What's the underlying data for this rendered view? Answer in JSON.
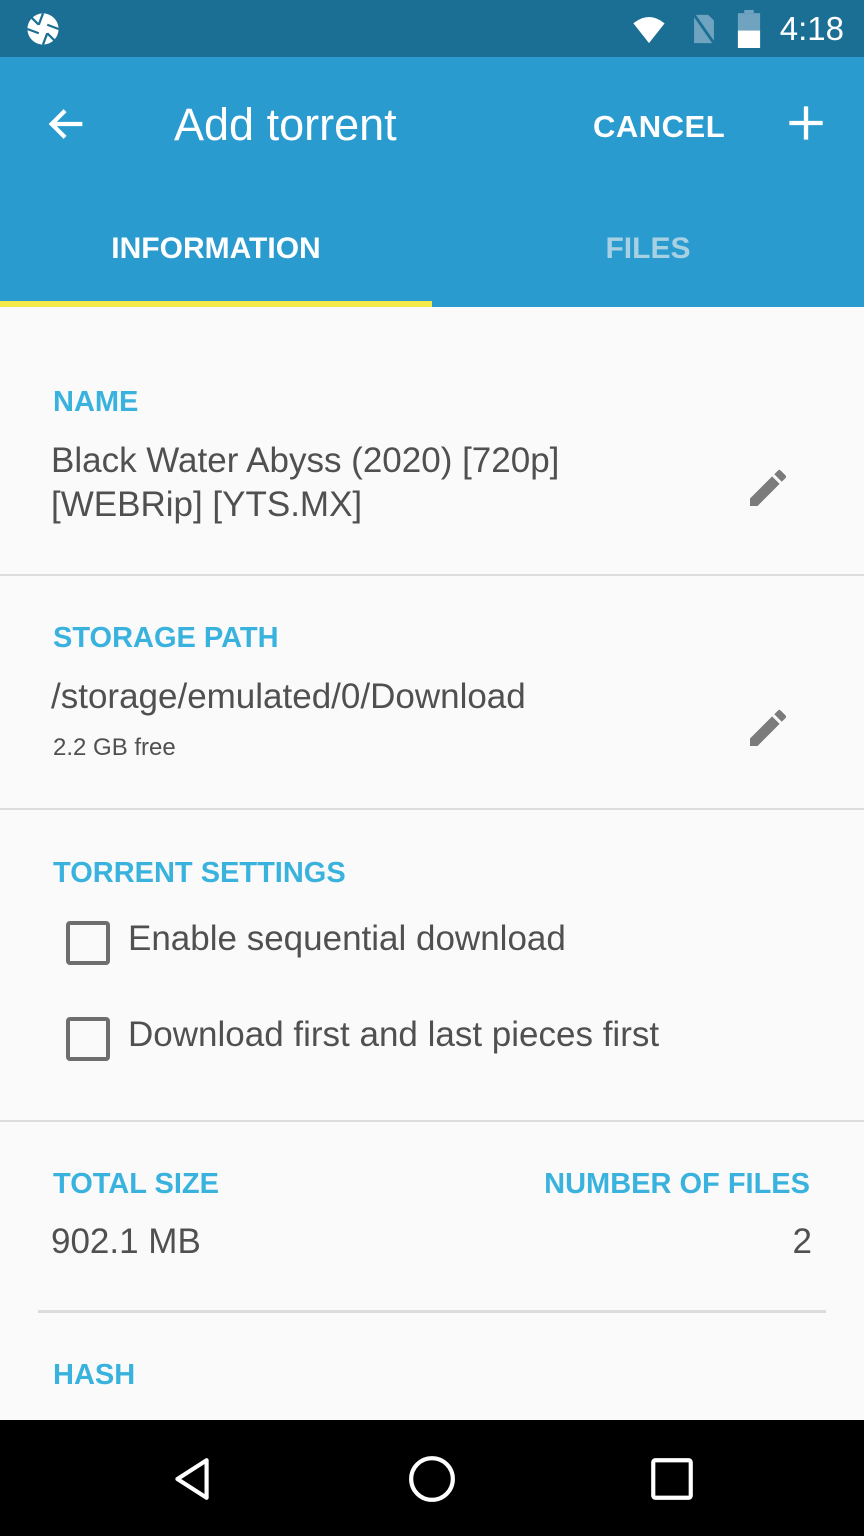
{
  "status_bar": {
    "time": "4:18",
    "icons": [
      "aperture-icon",
      "wifi-icon",
      "no-sim-icon",
      "battery-icon"
    ]
  },
  "app_bar": {
    "title": "Add torrent",
    "back_icon": "arrow-back-icon",
    "cancel_label": "CANCEL",
    "add_icon": "plus-icon"
  },
  "tabs": [
    {
      "label": "INFORMATION",
      "active": true
    },
    {
      "label": "FILES",
      "active": false
    }
  ],
  "name_section": {
    "label": "NAME",
    "value_line1": "Black Water Abyss (2020) [720p]",
    "value_line2": "[WEBRip] [YTS.MX]"
  },
  "storage_section": {
    "label": "STORAGE PATH",
    "path": "/storage/emulated/0/Download",
    "free": "2.2 GB free"
  },
  "settings_section": {
    "label": "TORRENT SETTINGS",
    "options": [
      {
        "label": "Enable sequential download",
        "checked": false
      },
      {
        "label": "Download first and last pieces first",
        "checked": false
      }
    ]
  },
  "size_section": {
    "total_size_label": "TOTAL SIZE",
    "total_size_value": "902.1 MB",
    "num_files_label": "NUMBER OF FILES",
    "num_files_value": "2"
  },
  "hash_section": {
    "label": "HASH"
  },
  "nav_bar": {
    "buttons": [
      "back-triangle-icon",
      "home-circle-icon",
      "recents-square-icon"
    ]
  },
  "colors": {
    "status_bar": "#1b6f94",
    "app_bar": "#2a9bcf",
    "accent": "#39b2de",
    "tab_indicator": "#f3e94a"
  }
}
